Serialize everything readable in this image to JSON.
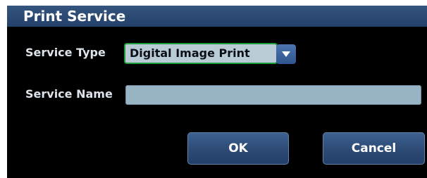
{
  "dialog": {
    "title": "Print Service",
    "accent_color": "#2a4a76",
    "service_type": {
      "label": "Service Type",
      "selected_value": "Digital Image Print",
      "arrow_icon": "chevron-down-icon"
    },
    "service_name": {
      "label": "Service Name",
      "value": ""
    },
    "buttons": {
      "ok_label": "OK",
      "cancel_label": "Cancel"
    }
  }
}
